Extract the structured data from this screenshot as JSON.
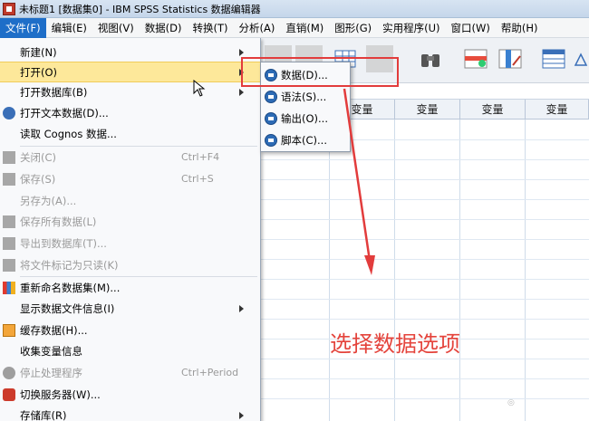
{
  "window": {
    "title": "未标题1 [数据集0] - IBM SPSS Statistics 数据编辑器"
  },
  "menubar": {
    "items": [
      {
        "label": "文件(F)",
        "active": true
      },
      {
        "label": "编辑(E)"
      },
      {
        "label": "视图(V)"
      },
      {
        "label": "数据(D)"
      },
      {
        "label": "转换(T)"
      },
      {
        "label": "分析(A)"
      },
      {
        "label": "直销(M)"
      },
      {
        "label": "图形(G)"
      },
      {
        "label": "实用程序(U)"
      },
      {
        "label": "窗口(W)"
      },
      {
        "label": "帮助(H)"
      }
    ]
  },
  "file_menu": {
    "items": [
      {
        "label": "新建(N)",
        "submenu": true,
        "icon": "none"
      },
      {
        "label": "打开(O)",
        "submenu": true,
        "highlighted": true,
        "icon": "none"
      },
      {
        "label": "打开数据库(B)",
        "submenu": true,
        "icon": "none"
      },
      {
        "label": "打开文本数据(D)...",
        "icon": "text-data-icon"
      },
      {
        "label": "读取 Cognos 数据...",
        "icon": "none"
      },
      {
        "label": "关闭(C)",
        "shortcut": "Ctrl+F4",
        "disabled": true,
        "icon": "close-file-icon"
      },
      {
        "label": "保存(S)",
        "shortcut": "Ctrl+S",
        "disabled": true,
        "icon": "save-icon"
      },
      {
        "label": "另存为(A)...",
        "disabled": true,
        "icon": "none"
      },
      {
        "label": "保存所有数据(L)",
        "disabled": true,
        "icon": "save-all-icon"
      },
      {
        "label": "导出到数据库(T)...",
        "disabled": true,
        "icon": "export-db-icon"
      },
      {
        "label": "将文件标记为只读(K)",
        "disabled": true,
        "icon": "readonly-icon"
      },
      {
        "label": "重新命名数据集(M)...",
        "icon": "rename-dataset-icon"
      },
      {
        "label": "显示数据文件信息(I)",
        "submenu": true,
        "icon": "none"
      },
      {
        "label": "缓存数据(H)...",
        "icon": "cache-data-icon"
      },
      {
        "label": "收集变量信息",
        "icon": "none"
      },
      {
        "label": "停止处理程序",
        "shortcut": "Ctrl+Period",
        "disabled": true,
        "icon": "stop-icon"
      },
      {
        "label": "切换服务器(W)...",
        "icon": "server-icon"
      },
      {
        "label": "存储库(R)",
        "submenu": true,
        "icon": "none"
      }
    ]
  },
  "open_submenu": {
    "items": [
      {
        "label": "数据(D)..."
      },
      {
        "label": "语法(S)..."
      },
      {
        "label": "输出(O)..."
      },
      {
        "label": "脚本(C)..."
      }
    ]
  },
  "grid": {
    "columns": [
      "变量",
      "变量",
      "变量",
      "变量"
    ]
  },
  "annotation": {
    "text": "选择数据选项"
  },
  "colors": {
    "menu_highlight": "#fde89a",
    "menubar_active": "#1e6ec8",
    "annotation": "#e4443c"
  }
}
